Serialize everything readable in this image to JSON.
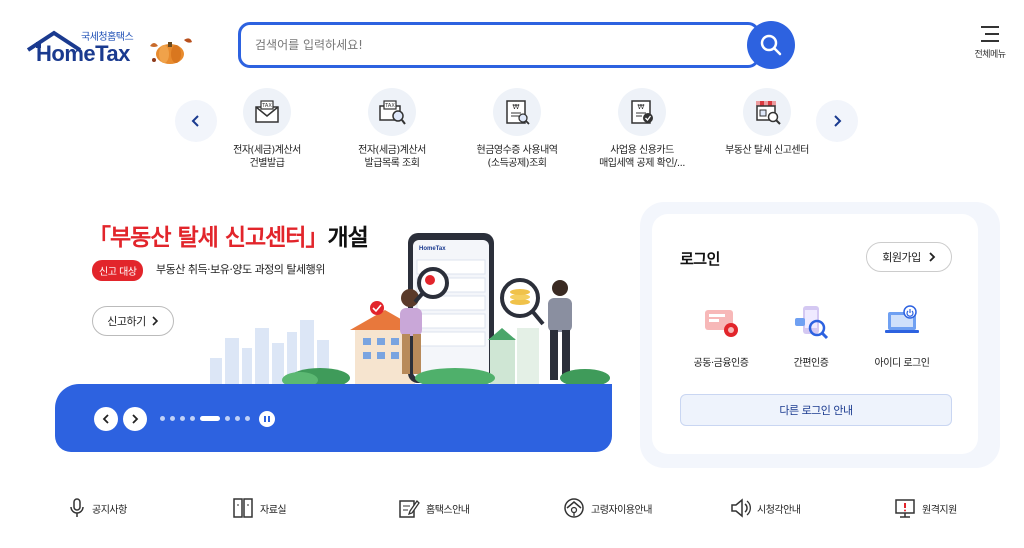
{
  "header": {
    "logo_sub": "국세청홈택스",
    "logo_main": "HomeTax",
    "search_placeholder": "검색어를 입력하세요!",
    "menu_label": "전체메뉴"
  },
  "quick_menu": {
    "items": [
      {
        "label_1": "전자(세금)계산서",
        "label_2": "건별발급",
        "icon": "tax-envelope-icon"
      },
      {
        "label_1": "전자(세금)계산서",
        "label_2": "발급목록 조회",
        "icon": "tax-search-icon"
      },
      {
        "label_1": "현금영수증 사용내역",
        "label_2": "(소득공제)조회",
        "icon": "receipt-icon"
      },
      {
        "label_1": "사업용 신용카드",
        "label_2": "매입세액 공제 확인/...",
        "icon": "card-document-icon"
      },
      {
        "label_1": "부동산 탈세 신고센터",
        "label_2": "",
        "icon": "store-search-icon"
      }
    ]
  },
  "banner": {
    "title_red": "「부동산 탈세 신고센터」",
    "title_black": "개설",
    "badge": "신고 대상",
    "description": "부동산 취득·보유·양도 과정의 탈세행위",
    "button": "신고하기",
    "slides_total": 8,
    "slide_active": 5
  },
  "login": {
    "title": "로그인",
    "join_button": "회원가입",
    "options": [
      {
        "label": "공동·금융인증"
      },
      {
        "label": "간편인증"
      },
      {
        "label": "아이디 로그인"
      }
    ],
    "other_button": "다른 로그인 안내"
  },
  "footer": {
    "items": [
      {
        "label": "공지사항"
      },
      {
        "label": "자료실"
      },
      {
        "label": "홈택스안내"
      },
      {
        "label": "고령자이용안내"
      },
      {
        "label": "시청각안내"
      },
      {
        "label": "원격지원"
      }
    ]
  },
  "colors": {
    "primary": "#2d62e0",
    "accent_red": "#e2252b",
    "navy": "#1a3a8f"
  }
}
